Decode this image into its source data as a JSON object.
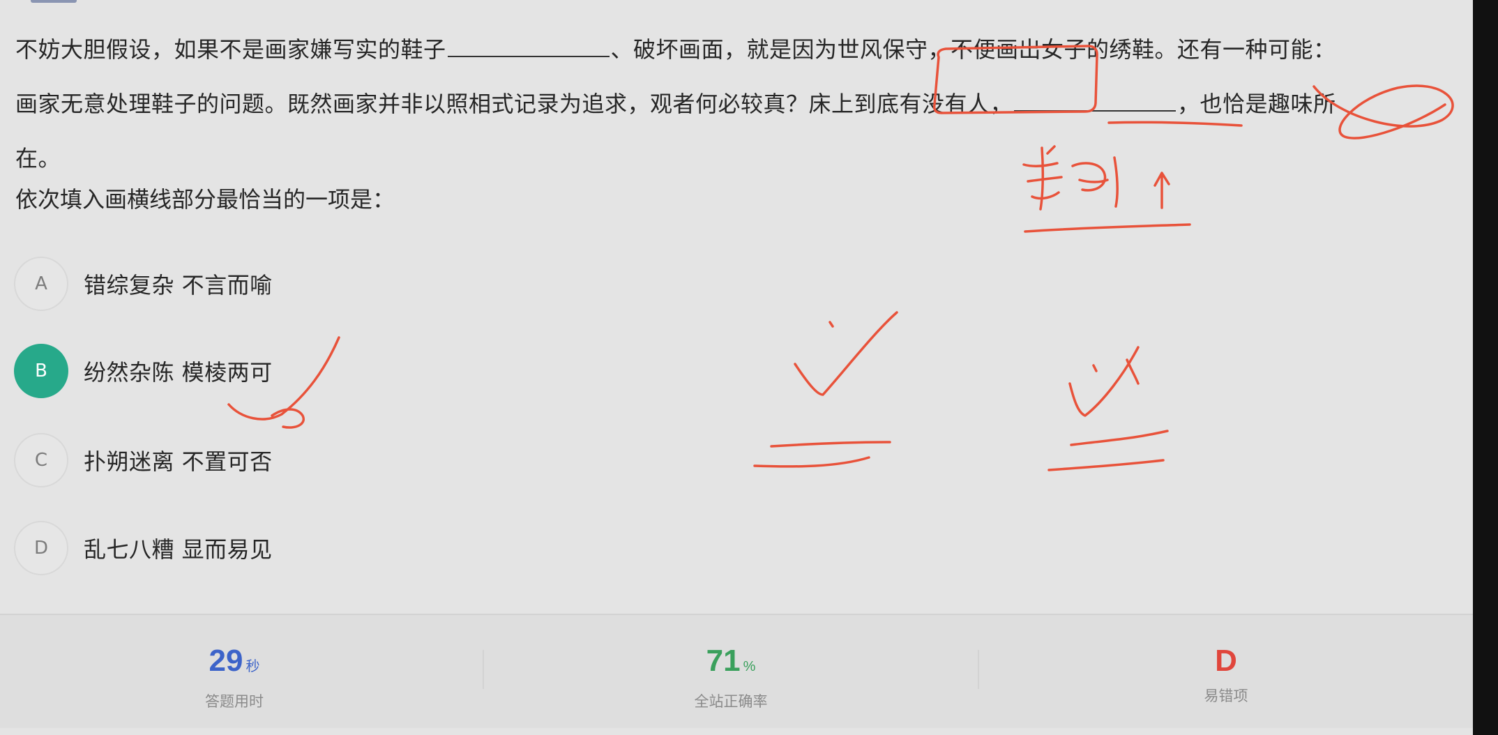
{
  "question": {
    "line1a": "不妨大胆假设，如果不是画家嫌写实的鞋子",
    "line1b": "、破坏画面，就是因为世风保守，不便画出女子的绣鞋。还有一种可能：",
    "line2a": "画家无意处理鞋子的问题。既然画家并非以照相式记录为追求，观者何必较真？床上到底有没有人，",
    "line2b": "，也恰是趣味所",
    "line3": "在。",
    "prompt": "依次填入画横线部分最恰当的一项是："
  },
  "options": [
    {
      "letter": "A",
      "text": "错综复杂 不言而喻",
      "selected": false
    },
    {
      "letter": "B",
      "text": "纷然杂陈 模棱两可",
      "selected": true
    },
    {
      "letter": "C",
      "text": "扑朔迷离 不置可否",
      "selected": false
    },
    {
      "letter": "D",
      "text": "乱七八糟 显而易见",
      "selected": false
    }
  ],
  "stats": {
    "time_value": "29",
    "time_unit": "秒",
    "time_label": "答题用时",
    "accuracy_value": "71",
    "accuracy_unit": "%",
    "accuracy_label": "全站正确率",
    "common_wrong_value": "D",
    "common_wrong_label": "易错项"
  },
  "colors": {
    "selected_option": "#27a98a",
    "time_value": "#3c63c9",
    "accuracy_value": "#3aa05c",
    "common_wrong_value": "#e0463c",
    "annotation_ink": "#e8523a",
    "background": "#e4e4e4"
  }
}
